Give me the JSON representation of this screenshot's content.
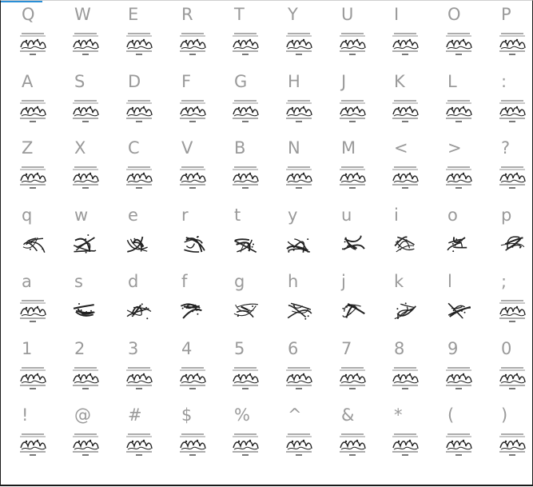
{
  "grid": {
    "rows": [
      {
        "cells": [
          {
            "char": "Q",
            "glyph": "placeholder-glyph"
          },
          {
            "char": "W",
            "glyph": "placeholder-glyph"
          },
          {
            "char": "E",
            "glyph": "placeholder-glyph"
          },
          {
            "char": "R",
            "glyph": "placeholder-glyph"
          },
          {
            "char": "T",
            "glyph": "placeholder-glyph"
          },
          {
            "char": "Y",
            "glyph": "placeholder-glyph"
          },
          {
            "char": "U",
            "glyph": "placeholder-glyph"
          },
          {
            "char": "I",
            "glyph": "placeholder-glyph"
          },
          {
            "char": "O",
            "glyph": "placeholder-glyph"
          },
          {
            "char": "P",
            "glyph": "placeholder-glyph"
          }
        ]
      },
      {
        "cells": [
          {
            "char": "A",
            "glyph": "placeholder-glyph"
          },
          {
            "char": "S",
            "glyph": "placeholder-glyph"
          },
          {
            "char": "D",
            "glyph": "placeholder-glyph"
          },
          {
            "char": "F",
            "glyph": "placeholder-glyph"
          },
          {
            "char": "G",
            "glyph": "placeholder-glyph"
          },
          {
            "char": "H",
            "glyph": "placeholder-glyph"
          },
          {
            "char": "J",
            "glyph": "placeholder-glyph"
          },
          {
            "char": "K",
            "glyph": "placeholder-glyph"
          },
          {
            "char": "L",
            "glyph": "placeholder-glyph"
          },
          {
            "char": ":",
            "glyph": "placeholder-glyph"
          }
        ]
      },
      {
        "cells": [
          {
            "char": "Z",
            "glyph": "placeholder-glyph"
          },
          {
            "char": "X",
            "glyph": "placeholder-glyph"
          },
          {
            "char": "C",
            "glyph": "placeholder-glyph"
          },
          {
            "char": "V",
            "glyph": "placeholder-glyph"
          },
          {
            "char": "B",
            "glyph": "placeholder-glyph"
          },
          {
            "char": "N",
            "glyph": "placeholder-glyph"
          },
          {
            "char": "M",
            "glyph": "placeholder-glyph"
          },
          {
            "char": "<",
            "glyph": "placeholder-glyph"
          },
          {
            "char": ">",
            "glyph": "placeholder-glyph"
          },
          {
            "char": "?",
            "glyph": "placeholder-glyph"
          }
        ]
      },
      {
        "cells": [
          {
            "char": "q",
            "glyph": "calligraphy-glyph"
          },
          {
            "char": "w",
            "glyph": "calligraphy-glyph"
          },
          {
            "char": "e",
            "glyph": "calligraphy-glyph"
          },
          {
            "char": "r",
            "glyph": "calligraphy-glyph"
          },
          {
            "char": "t",
            "glyph": "calligraphy-glyph"
          },
          {
            "char": "y",
            "glyph": "calligraphy-glyph"
          },
          {
            "char": "u",
            "glyph": "calligraphy-glyph"
          },
          {
            "char": "i",
            "glyph": "calligraphy-glyph"
          },
          {
            "char": "o",
            "glyph": "calligraphy-glyph"
          },
          {
            "char": "p",
            "glyph": "calligraphy-glyph"
          }
        ]
      },
      {
        "cells": [
          {
            "char": "a",
            "glyph": "placeholder-glyph"
          },
          {
            "char": "s",
            "glyph": "calligraphy-glyph"
          },
          {
            "char": "d",
            "glyph": "calligraphy-glyph"
          },
          {
            "char": "f",
            "glyph": "calligraphy-glyph"
          },
          {
            "char": "g",
            "glyph": "calligraphy-glyph"
          },
          {
            "char": "h",
            "glyph": "calligraphy-glyph"
          },
          {
            "char": "j",
            "glyph": "calligraphy-glyph"
          },
          {
            "char": "k",
            "glyph": "calligraphy-glyph"
          },
          {
            "char": "l",
            "glyph": "calligraphy-glyph"
          },
          {
            "char": ";",
            "glyph": "placeholder-glyph"
          }
        ]
      },
      {
        "cells": [
          {
            "char": "1",
            "glyph": "placeholder-glyph"
          },
          {
            "char": "2",
            "glyph": "placeholder-glyph"
          },
          {
            "char": "3",
            "glyph": "placeholder-glyph"
          },
          {
            "char": "4",
            "glyph": "placeholder-glyph"
          },
          {
            "char": "5",
            "glyph": "placeholder-glyph"
          },
          {
            "char": "6",
            "glyph": "placeholder-glyph"
          },
          {
            "char": "7",
            "glyph": "placeholder-glyph"
          },
          {
            "char": "8",
            "glyph": "placeholder-glyph"
          },
          {
            "char": "9",
            "glyph": "placeholder-glyph"
          },
          {
            "char": "0",
            "glyph": "placeholder-glyph"
          }
        ]
      },
      {
        "cells": [
          {
            "char": "!",
            "glyph": "placeholder-glyph"
          },
          {
            "char": "@",
            "glyph": "placeholder-glyph"
          },
          {
            "char": "#",
            "glyph": "placeholder-glyph"
          },
          {
            "char": "$",
            "glyph": "placeholder-glyph"
          },
          {
            "char": "%",
            "glyph": "placeholder-glyph"
          },
          {
            "char": "^",
            "glyph": "placeholder-glyph"
          },
          {
            "char": "&",
            "glyph": "placeholder-glyph"
          },
          {
            "char": "*",
            "glyph": "placeholder-glyph"
          },
          {
            "char": "(",
            "glyph": "placeholder-glyph"
          },
          {
            "char": ")",
            "glyph": "placeholder-glyph"
          }
        ]
      }
    ]
  },
  "colors": {
    "label": "#9a9a9a",
    "ink": "#222222",
    "accent": "#2a8fd6"
  }
}
